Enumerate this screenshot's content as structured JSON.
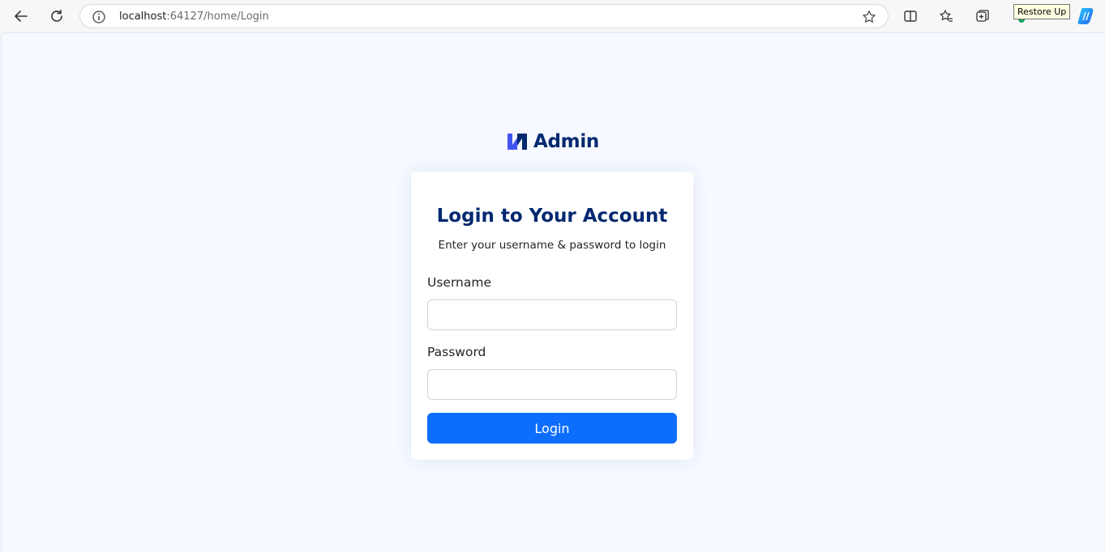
{
  "browser": {
    "address_host": "localhost",
    "address_rest": ":64127/home/Login",
    "tooltip": "Restore Up"
  },
  "brand": {
    "name": "Admin",
    "color": "#012970",
    "logo_color": "#4154f1"
  },
  "login": {
    "title": "Login to Your Account",
    "subtitle": "Enter your username & password to login",
    "username_label": "Username",
    "username_value": "",
    "password_label": "Password",
    "password_value": "",
    "submit_label": "Login",
    "button_color": "#0d6efd"
  }
}
